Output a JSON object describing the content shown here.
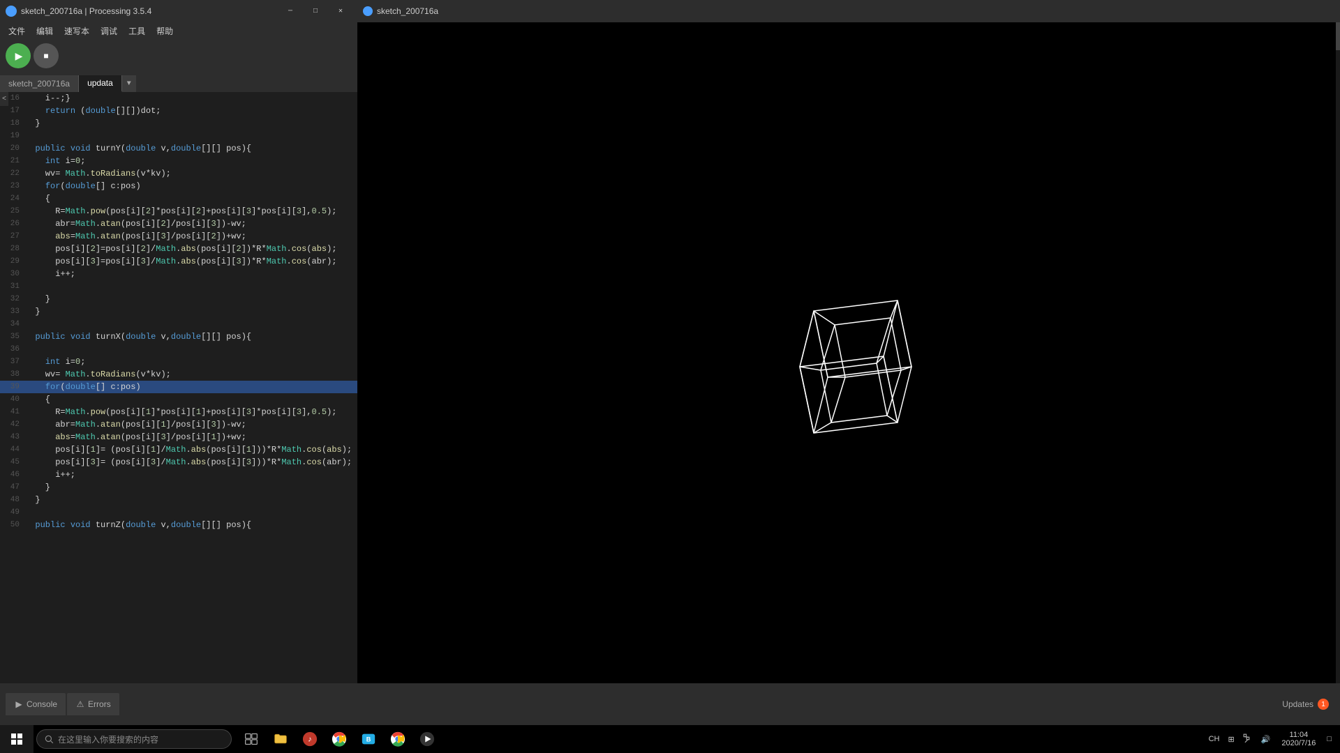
{
  "window": {
    "title": "sketch_200716a | Processing 3.5.4",
    "app_icon_color": "#4a9eff"
  },
  "menu": {
    "items": [
      "文件",
      "编辑",
      "速写本",
      "调试",
      "工具",
      "帮助"
    ]
  },
  "tabs": {
    "items": [
      {
        "label": "sketch_200716a",
        "active": false
      },
      {
        "label": "updata",
        "active": true
      }
    ]
  },
  "preview": {
    "title": "sketch_200716a"
  },
  "code": {
    "lines": [
      {
        "num": 16,
        "text": "    i--;}"
      },
      {
        "num": 17,
        "text": "    return (double[][])dot;"
      },
      {
        "num": 18,
        "text": "  }"
      },
      {
        "num": 19,
        "text": ""
      },
      {
        "num": 20,
        "text": "  public void turnY(double v,double[][] pos){"
      },
      {
        "num": 21,
        "text": "    int i=0;"
      },
      {
        "num": 22,
        "text": "    wv= Math.toRadians(v*kv);"
      },
      {
        "num": 23,
        "text": "    for(double[] c:pos)"
      },
      {
        "num": 24,
        "text": "    {"
      },
      {
        "num": 25,
        "text": "      R=Math.pow(pos[i][2]*pos[i][2]+pos[i][3]*pos[i][3],0.5);"
      },
      {
        "num": 26,
        "text": "      abr=Math.atan(pos[i][2]/pos[i][3])-wv;"
      },
      {
        "num": 27,
        "text": "      abs=Math.atan(pos[i][3]/pos[i][2])+wv;"
      },
      {
        "num": 28,
        "text": "      pos[i][2]=pos[i][2]/Math.abs(pos[i][2])*R*Math.cos(abs);"
      },
      {
        "num": 29,
        "text": "      pos[i][3]=pos[i][3]/Math.abs(pos[i][3])*R*Math.cos(abr);"
      },
      {
        "num": 30,
        "text": "      i++;"
      },
      {
        "num": 31,
        "text": ""
      },
      {
        "num": 32,
        "text": "    }"
      },
      {
        "num": 33,
        "text": "  }"
      },
      {
        "num": 34,
        "text": ""
      },
      {
        "num": 35,
        "text": "  public void turnX(double v,double[][] pos){"
      },
      {
        "num": 36,
        "text": ""
      },
      {
        "num": 37,
        "text": "    int i=0;"
      },
      {
        "num": 38,
        "text": "    wv= Math.toRadians(v*kv);"
      },
      {
        "num": 39,
        "text": "    for(double[] c:pos)",
        "highlighted": true
      },
      {
        "num": 40,
        "text": "    {"
      },
      {
        "num": 41,
        "text": "      R=Math.pow(pos[i][1]*pos[i][1]+pos[i][3]*pos[i][3],0.5);"
      },
      {
        "num": 42,
        "text": "      abr=Math.atan(pos[i][1]/pos[i][3])-wv;"
      },
      {
        "num": 43,
        "text": "      abs=Math.atan(pos[i][3]/pos[i][1])+wv;"
      },
      {
        "num": 44,
        "text": "      pos[i][1]= (pos[i][1]/Math.abs(pos[i][1]))*R*Math.cos(abs);"
      },
      {
        "num": 45,
        "text": "      pos[i][3]= (pos[i][3]/Math.abs(pos[i][3]))*R*Math.cos(abr);"
      },
      {
        "num": 46,
        "text": "      i++;"
      },
      {
        "num": 47,
        "text": "    }"
      },
      {
        "num": 48,
        "text": "  }"
      },
      {
        "num": 49,
        "text": ""
      },
      {
        "num": 50,
        "text": "  public void turnZ(double v,double[][] pos){"
      }
    ]
  },
  "bottom_panel": {
    "console_label": "Console",
    "errors_label": "Errors",
    "updates_label": "Updates",
    "updates_count": "1"
  },
  "taskbar": {
    "search_placeholder": "在这里输入你要搜索的内容",
    "clock_time": "11:04",
    "clock_date": "2020/7/16"
  }
}
